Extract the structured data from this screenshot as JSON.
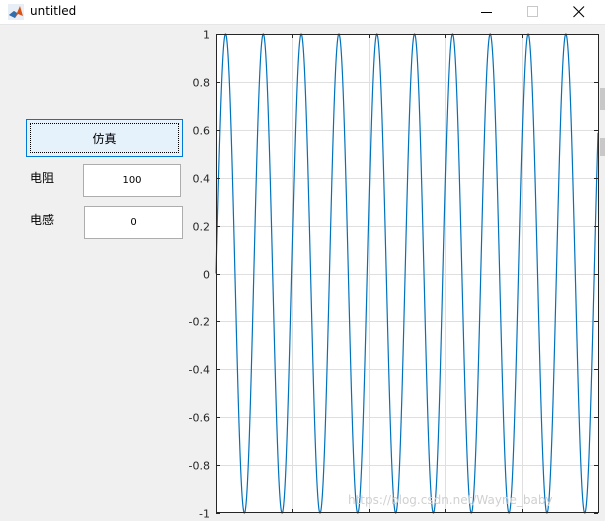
{
  "window": {
    "title": "untitled",
    "icon": "matlab-icon"
  },
  "controls": {
    "simulate_button": "仿真",
    "resistance_label": "电阻",
    "resistance_value": "100",
    "inductance_label": "电感",
    "inductance_value": "0"
  },
  "chart_data": {
    "type": "line",
    "title": "",
    "xlabel": "",
    "ylabel": "",
    "ylim": [
      -1,
      1
    ],
    "yticks": [
      1,
      0.8,
      0.6,
      0.4,
      0.2,
      0,
      -0.2,
      -0.4,
      -0.6,
      -0.8,
      -1
    ],
    "ytick_labels": [
      "1",
      "0.8",
      "0.6",
      "0.4",
      "0.2",
      "0",
      "-0.2",
      "-0.4",
      "-0.6",
      "-0.8",
      "-1"
    ],
    "xlim": [
      0,
      1
    ],
    "xgrid_positions": [
      0.2,
      0.4,
      0.6,
      0.8
    ],
    "grid": true,
    "series": [
      {
        "function": "sin",
        "cycles": 10.1,
        "amplitude": 1,
        "color": "#0072bd"
      }
    ]
  },
  "watermark": "https://blog.csdn.net/Wayne_baby",
  "colors": {
    "line": "#0072bd",
    "grid": "#dfdfdf",
    "axis": "#262626",
    "button_bg": "#e5f1fb",
    "button_border": "#0078d7",
    "figure_bg": "#f0f0f0"
  }
}
